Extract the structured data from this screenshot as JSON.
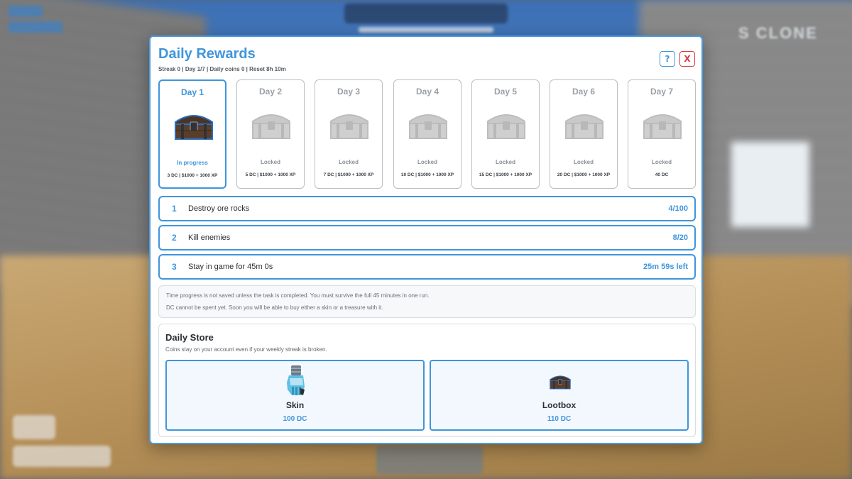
{
  "hud": {
    "logo": "S CLONE"
  },
  "modal": {
    "title": "Daily Rewards",
    "subtitle": "Streak 0 | Day 1/7 | Daily coins 0 | Reset 8h 10m",
    "help_label": "?",
    "close_label": "X"
  },
  "days": [
    {
      "label": "Day 1",
      "status": "In progress",
      "reward": "3 DC | $1000 + 1000 XP",
      "icon": "treasure-chest-icon"
    },
    {
      "label": "Day 2",
      "status": "Locked",
      "reward": "5 DC | $1000 + 1000 XP",
      "icon": "treasure-chest-icon"
    },
    {
      "label": "Day 3",
      "status": "Locked",
      "reward": "7 DC | $1000 + 1000 XP",
      "icon": "treasure-chest-icon"
    },
    {
      "label": "Day 4",
      "status": "Locked",
      "reward": "10 DC | $1000 + 1000 XP",
      "icon": "treasure-chest-icon"
    },
    {
      "label": "Day 5",
      "status": "Locked",
      "reward": "15 DC | $1000 + 1000 XP",
      "icon": "treasure-chest-icon"
    },
    {
      "label": "Day 6",
      "status": "Locked",
      "reward": "20 DC | $1000 + 1000 XP",
      "icon": "treasure-chest-icon"
    },
    {
      "label": "Day 7",
      "status": "Locked",
      "reward": "40 DC",
      "icon": "treasure-chest-icon"
    }
  ],
  "tasks": [
    {
      "num": "1",
      "name": "Destroy ore rocks",
      "progress": "4/100"
    },
    {
      "num": "2",
      "name": "Kill enemies",
      "progress": "8/20"
    },
    {
      "num": "3",
      "name": "Stay in game for 45m 0s",
      "progress": "25m 59s left"
    }
  ],
  "note": {
    "line1": "Time progress is not saved unless the task is completed. You must survive the full 45 minutes in one run.",
    "line2": "DC cannot be spent yet. Soon you will be able to buy either a skin or a treasure with it."
  },
  "store": {
    "title": "Daily Store",
    "subtitle": "Coins stay on your account even if your weekly streak is broken.",
    "items": [
      {
        "name": "Skin",
        "price": "100 DC",
        "icon": "glove-skin-icon"
      },
      {
        "name": "Lootbox",
        "price": "110 DC",
        "icon": "treasure-chest-icon"
      }
    ]
  },
  "colors": {
    "accent": "#3f95dc",
    "close": "#d93c3c",
    "border": "#b9bec4"
  }
}
